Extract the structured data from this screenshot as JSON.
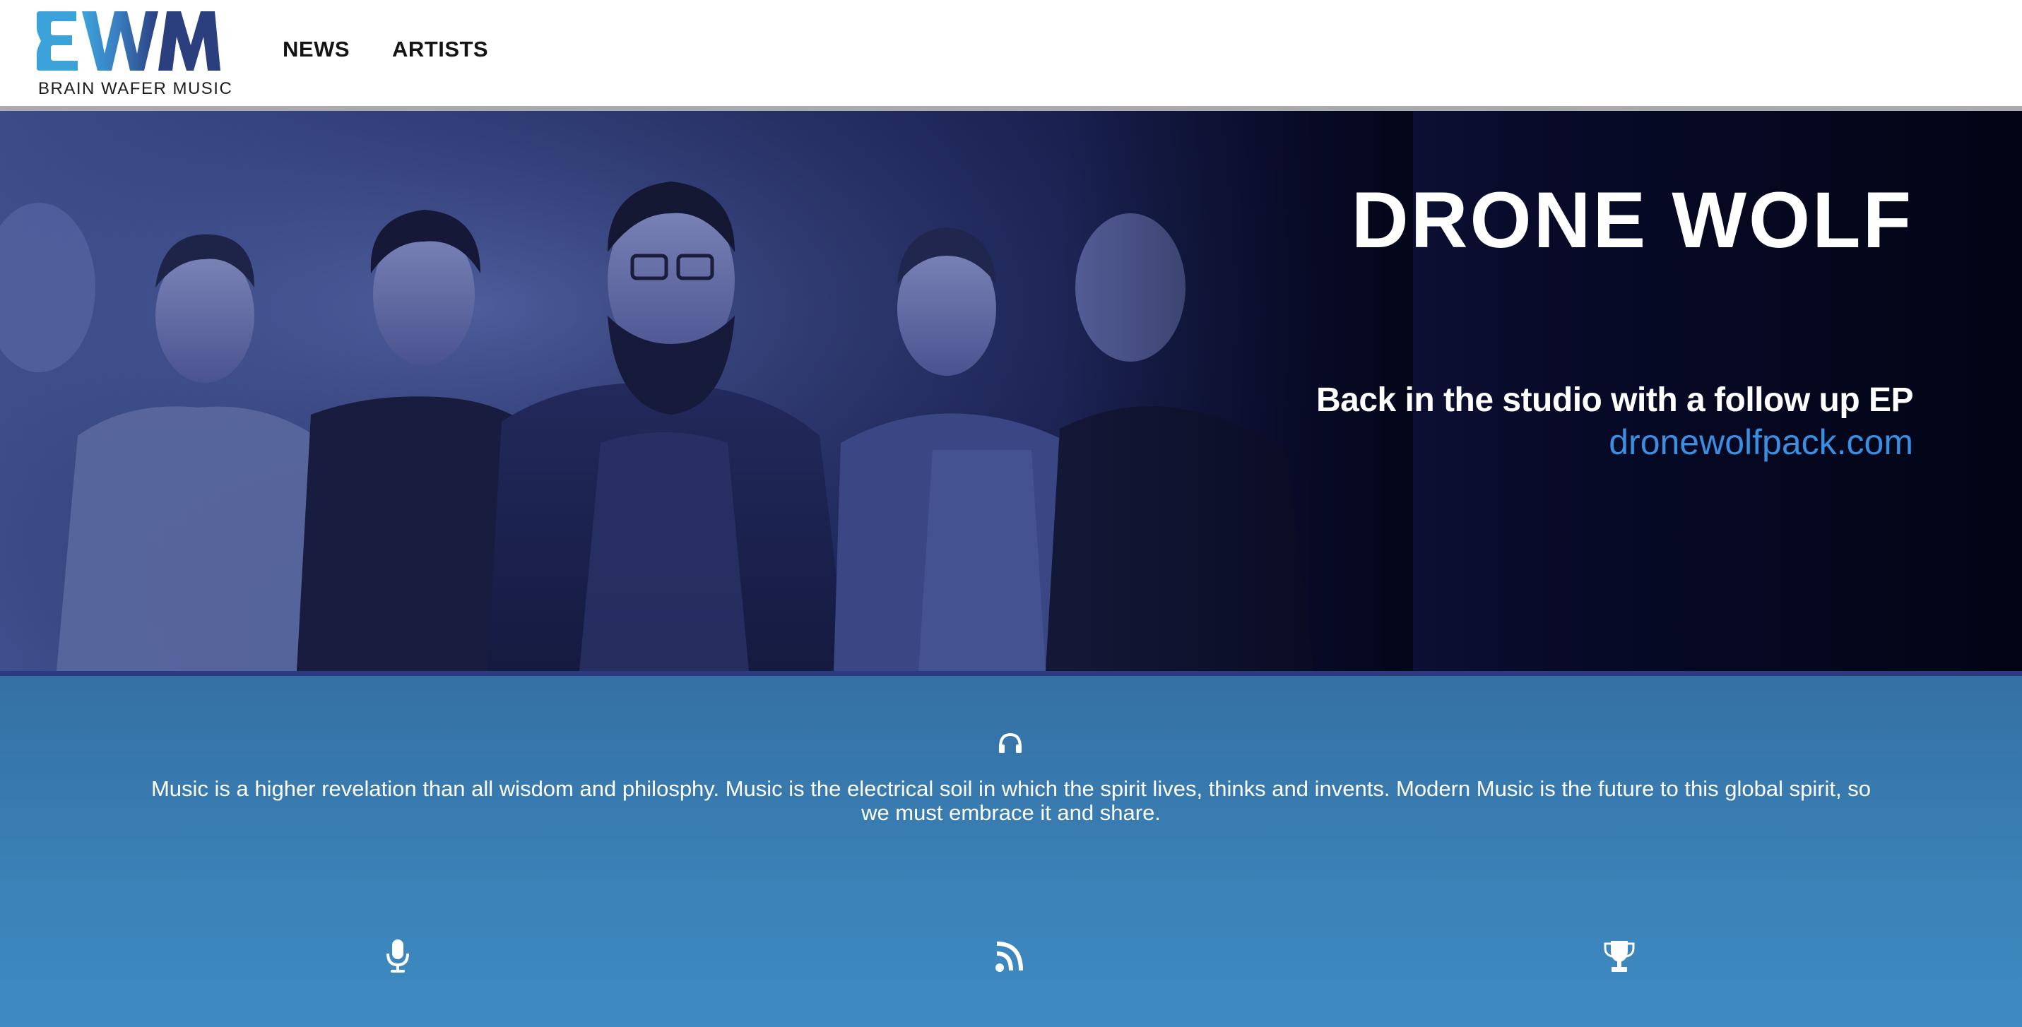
{
  "brand": {
    "logo_letters": "BWM",
    "name": "BRAIN WAFER MUSIC",
    "colors": {
      "light": "#3ba3d9",
      "dark": "#2b3f7e"
    }
  },
  "nav": {
    "items": [
      {
        "label": "NEWS"
      },
      {
        "label": "ARTISTS"
      }
    ]
  },
  "hero": {
    "title": "DRONE WOLF",
    "subtitle": "Back in the studio with a follow up EP",
    "link": "dronewolfpack.com",
    "link_color": "#3b8ee0"
  },
  "mission": {
    "icon": "headphones-icon",
    "text": "Music is a higher revelation than all wisdom and philosphy. Music is the electrical soil in which the spirit lives, thinks and invents. Modern Music is the future to this global spirit, so we must embrace it and share."
  },
  "features": [
    {
      "icon": "microphone-icon"
    },
    {
      "icon": "rss-icon"
    },
    {
      "icon": "trophy-icon"
    }
  ]
}
